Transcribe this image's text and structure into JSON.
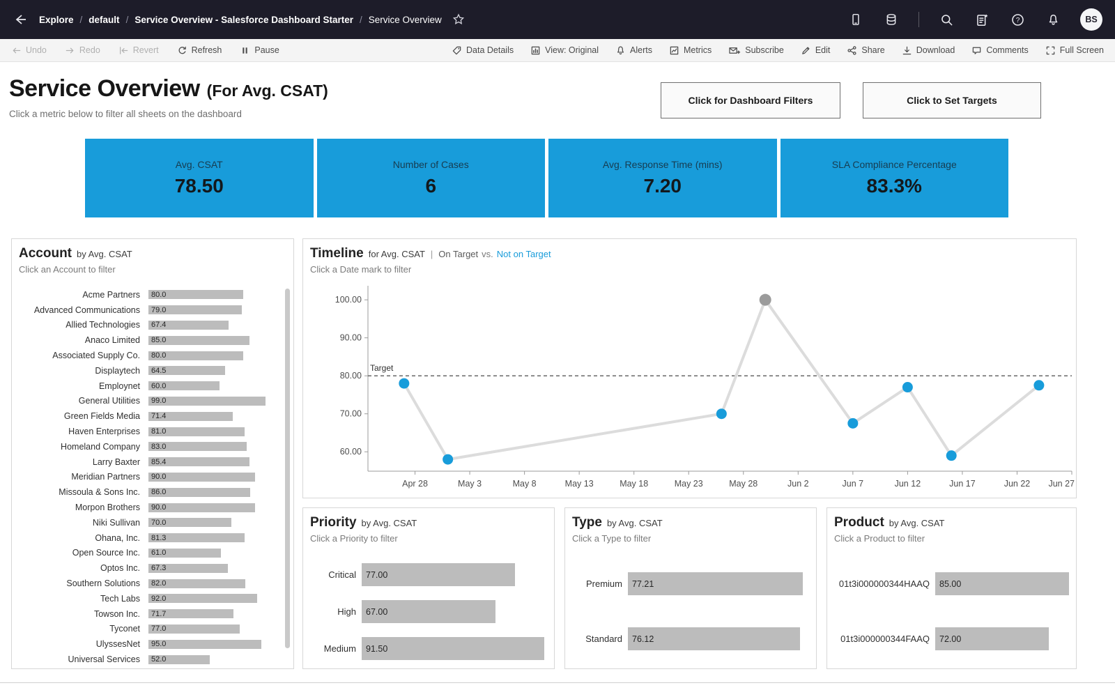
{
  "topnav": {
    "breadcrumb": [
      "Explore",
      "default",
      "Service Overview - Salesforce Dashboard Starter",
      "Service Overview"
    ],
    "separator": "/",
    "right_icons": [
      "mobile-icon",
      "data-source-icon",
      "divider",
      "search-icon",
      "release-notes-icon",
      "help-icon",
      "notifications-icon"
    ],
    "avatar_initials": "BS"
  },
  "toolbar": {
    "left_items": [
      {
        "label": "Undo",
        "icon": "undo-icon",
        "disabled": true
      },
      {
        "label": "Redo",
        "icon": "redo-icon",
        "disabled": true
      },
      {
        "label": "Revert",
        "icon": "revert-icon",
        "disabled": true
      },
      {
        "label": "Refresh",
        "icon": "refresh-icon",
        "disabled": false
      },
      {
        "label": "Pause",
        "icon": "pause-icon",
        "disabled": false
      }
    ],
    "right_items": [
      {
        "label": "Data Details",
        "icon": "tag-icon"
      },
      {
        "label": "View: Original",
        "icon": "view-icon"
      },
      {
        "label": "Alerts",
        "icon": "bell-icon"
      },
      {
        "label": "Metrics",
        "icon": "metrics-icon"
      },
      {
        "label": "Subscribe",
        "icon": "subscribe-icon"
      },
      {
        "label": "Edit",
        "icon": "pencil-icon"
      },
      {
        "label": "Share",
        "icon": "share-icon"
      },
      {
        "label": "Download",
        "icon": "download-icon"
      },
      {
        "label": "Comments",
        "icon": "comments-icon"
      },
      {
        "label": "Full Screen",
        "icon": "fullscreen-icon"
      }
    ]
  },
  "header": {
    "title": "Service Overview",
    "title_qualifier": "(For Avg. CSAT)",
    "subtitle": "Click a metric below to filter all sheets on the dashboard",
    "filters_button": "Click for Dashboard Filters",
    "targets_button": "Click to Set Targets"
  },
  "kpis": [
    {
      "label": "Avg. CSAT",
      "value": "78.50"
    },
    {
      "label": "Number of Cases",
      "value": "6"
    },
    {
      "label": "Avg. Response Time (mins)",
      "value": "7.20"
    },
    {
      "label": "SLA Compliance Percentage",
      "value": "83.3%"
    }
  ],
  "colors": {
    "kpi_blue": "#189CDA",
    "bar_gray": "#BCBCBC",
    "point_blue": "#189CDA",
    "point_gray": "#9B9B9B",
    "line_gray": "#DCDCDC"
  },
  "account_panel": {
    "title": "Account",
    "title_suffix": "by Avg. CSAT",
    "hint": "Click an Account to filter",
    "chart_data": {
      "type": "bar",
      "orientation": "horizontal",
      "xmax": 100,
      "rows": [
        {
          "label": "Acme Partners",
          "value": 80.0,
          "value_label": "80.0"
        },
        {
          "label": "Advanced Communications",
          "value": 79.0,
          "value_label": "79.0"
        },
        {
          "label": "Allied Technologies",
          "value": 67.4,
          "value_label": "67.4"
        },
        {
          "label": "Anaco Limited",
          "value": 85.0,
          "value_label": "85.0"
        },
        {
          "label": "Associated Supply Co.",
          "value": 80.0,
          "value_label": "80.0"
        },
        {
          "label": "Displaytech",
          "value": 64.5,
          "value_label": "64.5"
        },
        {
          "label": "Employnet",
          "value": 60.0,
          "value_label": "60.0"
        },
        {
          "label": "General Utilities",
          "value": 99.0,
          "value_label": "99.0"
        },
        {
          "label": "Green Fields Media",
          "value": 71.4,
          "value_label": "71.4"
        },
        {
          "label": "Haven Enterprises",
          "value": 81.0,
          "value_label": "81.0"
        },
        {
          "label": "Homeland Company",
          "value": 83.0,
          "value_label": "83.0"
        },
        {
          "label": "Larry Baxter",
          "value": 85.4,
          "value_label": "85.4"
        },
        {
          "label": "Meridian Partners",
          "value": 90.0,
          "value_label": "90.0"
        },
        {
          "label": "Missoula & Sons Inc.",
          "value": 86.0,
          "value_label": "86.0"
        },
        {
          "label": "Morpon Brothers",
          "value": 90.0,
          "value_label": "90.0"
        },
        {
          "label": "Niki Sullivan",
          "value": 70.0,
          "value_label": "70.0"
        },
        {
          "label": "Ohana, Inc.",
          "value": 81.3,
          "value_label": "81.3"
        },
        {
          "label": "Open Source Inc.",
          "value": 61.0,
          "value_label": "61.0"
        },
        {
          "label": "Optos Inc.",
          "value": 67.3,
          "value_label": "67.3"
        },
        {
          "label": "Southern Solutions",
          "value": 82.0,
          "value_label": "82.0"
        },
        {
          "label": "Tech Labs",
          "value": 92.0,
          "value_label": "92.0"
        },
        {
          "label": "Towson Inc.",
          "value": 71.7,
          "value_label": "71.7"
        },
        {
          "label": "Tyconet",
          "value": 77.0,
          "value_label": "77.0"
        },
        {
          "label": "UlyssesNet",
          "value": 95.0,
          "value_label": "95.0"
        },
        {
          "label": "Universal Services",
          "value": 52.0,
          "value_label": "52.0"
        }
      ]
    }
  },
  "timeline_panel": {
    "title": "Timeline",
    "title_suffix": "for Avg. CSAT",
    "legend_separator": "|",
    "legend_on_target": "On Target",
    "legend_vs": "vs.",
    "legend_not_on_target": "Not on Target",
    "hint": "Click a Date mark to filter",
    "chart_data": {
      "type": "line",
      "target": {
        "label": "Target",
        "value": 80
      },
      "ylim": [
        54.9,
        103.7
      ],
      "xlim_days": [
        -4.3,
        60
      ],
      "yticks": [
        {
          "v": 60,
          "label": "60.00"
        },
        {
          "v": 70,
          "label": "70.00"
        },
        {
          "v": 80,
          "label": "80.00"
        },
        {
          "v": 90,
          "label": "90.00"
        },
        {
          "v": 100,
          "label": "100.00"
        }
      ],
      "xticks": [
        {
          "d": 0,
          "label": "Apr 28"
        },
        {
          "d": 5,
          "label": "May 3"
        },
        {
          "d": 10,
          "label": "May 8"
        },
        {
          "d": 15,
          "label": "May 13"
        },
        {
          "d": 20,
          "label": "May 18"
        },
        {
          "d": 25,
          "label": "May 23"
        },
        {
          "d": 30,
          "label": "May 28"
        },
        {
          "d": 35,
          "label": "Jun 2"
        },
        {
          "d": 40,
          "label": "Jun 7"
        },
        {
          "d": 45,
          "label": "Jun 12"
        },
        {
          "d": 50,
          "label": "Jun 17"
        },
        {
          "d": 55,
          "label": "Jun 22"
        },
        {
          "d": 60,
          "label": "Jun 27"
        }
      ],
      "points": [
        {
          "day": -1,
          "value": 78,
          "on_target": false
        },
        {
          "day": 3,
          "value": 58,
          "on_target": false
        },
        {
          "day": 28,
          "value": 70,
          "on_target": false
        },
        {
          "day": 32,
          "value": 100,
          "on_target": true
        },
        {
          "day": 40,
          "value": 67.5,
          "on_target": false
        },
        {
          "day": 45,
          "value": 77,
          "on_target": false
        },
        {
          "day": 49,
          "value": 59,
          "on_target": false
        },
        {
          "day": 57,
          "value": 77.5,
          "on_target": false
        }
      ]
    }
  },
  "priority_panel": {
    "title": "Priority",
    "title_suffix": "by Avg. CSAT",
    "hint": "Click a Priority to filter",
    "chart_data": {
      "type": "bar",
      "orientation": "horizontal",
      "xmax": 93,
      "rows": [
        {
          "label": "Critical",
          "value": 77.0,
          "value_label": "77.00"
        },
        {
          "label": "High",
          "value": 67.0,
          "value_label": "67.00"
        },
        {
          "label": "Medium",
          "value": 91.5,
          "value_label": "91.50"
        }
      ]
    }
  },
  "type_panel": {
    "title": "Type",
    "title_suffix": "by Avg. CSAT",
    "hint": "Click a Type to filter",
    "chart_data": {
      "type": "bar",
      "orientation": "horizontal",
      "xmax": 80,
      "rows": [
        {
          "label": "Premium",
          "value": 77.21,
          "value_label": "77.21"
        },
        {
          "label": "Standard",
          "value": 76.12,
          "value_label": "76.12"
        }
      ]
    }
  },
  "product_panel": {
    "title": "Product",
    "title_suffix": "by Avg. CSAT",
    "hint": "Click a Product to filter",
    "chart_data": {
      "type": "bar",
      "orientation": "horizontal",
      "xmax": 85,
      "rows": [
        {
          "label": "01t3i000000344HAAQ",
          "value": 85.0,
          "value_label": "85.00"
        },
        {
          "label": "01t3i000000344FAAQ",
          "value": 72.0,
          "value_label": "72.00"
        }
      ]
    }
  }
}
